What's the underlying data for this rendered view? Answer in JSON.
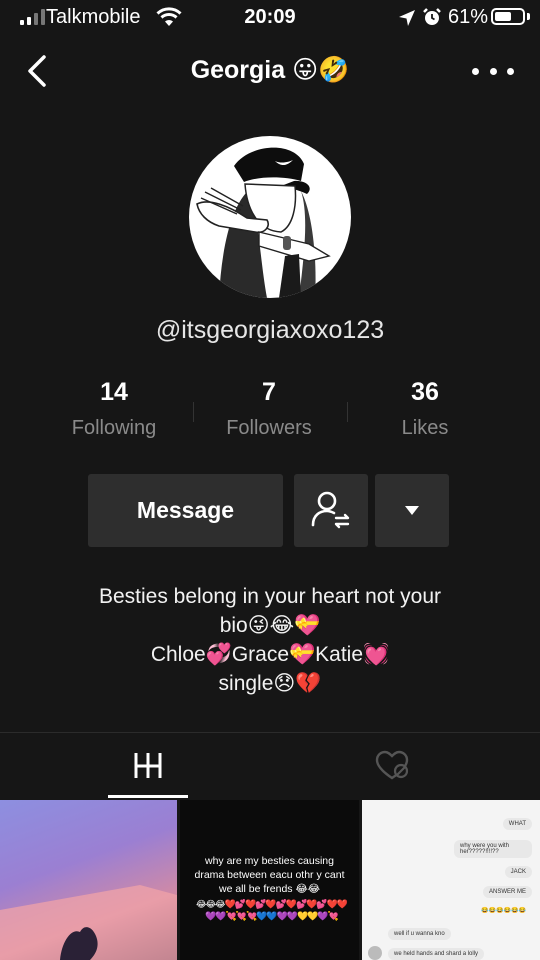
{
  "status_bar": {
    "carrier": "Talkmobile",
    "time": "20:09",
    "battery": "61%",
    "battery_level": 0.61
  },
  "header": {
    "title": "Georgia 😛🤣"
  },
  "profile": {
    "handle": "@itsgeorgiaxoxo123"
  },
  "stats": [
    {
      "value": "14",
      "label": "Following"
    },
    {
      "value": "7",
      "label": "Followers"
    },
    {
      "value": "36",
      "label": "Likes"
    }
  ],
  "actions": {
    "message_label": "Message"
  },
  "bio": {
    "lines": [
      "Besties belong in your heart not your",
      "bio😜😂💝",
      "Chloe💞Grace💝Katie💓",
      "single😞💔"
    ]
  },
  "icons": {
    "back": "chevron-left-icon",
    "more": "more-dots-icon",
    "follow": "user-swap-icon",
    "dropdown": "caret-down-icon",
    "grid_tab": "grid-icon",
    "liked_tab": "liked-heart-icon"
  },
  "videos": [
    {
      "caption": ""
    },
    {
      "caption": "why are my besties causing drama between eacu othr y cant we all be frends 😂😂",
      "emoji_rows": "😂😂😂❤️💕❤️💕❤️💕❤️💕❤️💕❤️❤️ 💜💜💘💘💘💙💙💜💜💛💛💜💘"
    },
    {
      "chat": [
        "WHAT",
        "why were you with her?????!!!!??",
        "JACK",
        "ANSWER ME",
        "😂😂😂😂😂😂",
        "well if u wanna kno",
        "we held hands and shard a lolly"
      ]
    }
  ]
}
